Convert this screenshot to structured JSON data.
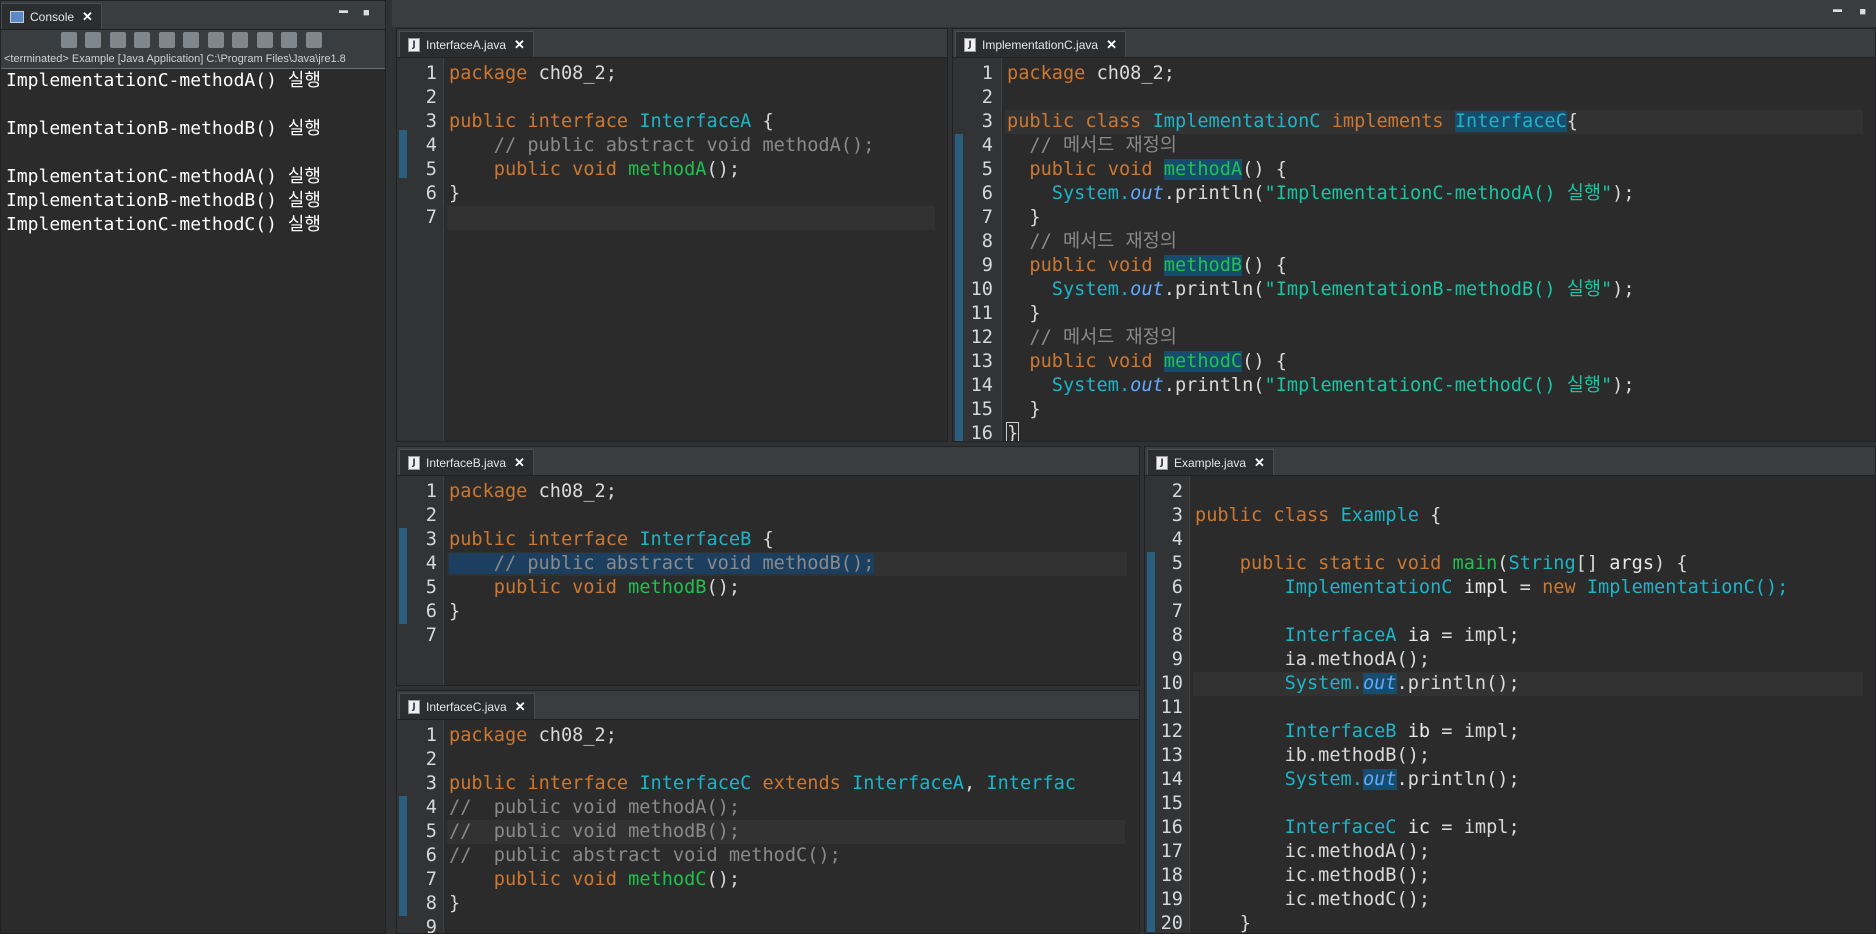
{
  "console": {
    "tab_label": "Console",
    "status": "<terminated> Example [Java Application] C:\\Program Files\\Java\\jre1.8",
    "output": [
      "ImplementationC-methodA() 실행",
      "",
      "ImplementationB-methodB() 실행",
      "",
      "ImplementationC-methodA() 실행",
      "ImplementationB-methodB() 실행",
      "ImplementationC-methodC() 실행"
    ]
  },
  "editors": {
    "interfaceA": {
      "tab": "InterfaceA.java",
      "line_numbers": [
        "1",
        "2",
        "3",
        "4",
        "5",
        "6",
        "7"
      ]
    },
    "implementationC": {
      "tab": "ImplementationC.java",
      "line_numbers": [
        "1",
        "2",
        "3",
        "4",
        "5",
        "6",
        "7",
        "8",
        "9",
        "10",
        "11",
        "12",
        "13",
        "14",
        "15",
        "16"
      ]
    },
    "interfaceB": {
      "tab": "InterfaceB.java",
      "line_numbers": [
        "1",
        "2",
        "3",
        "4",
        "5",
        "6",
        "7"
      ]
    },
    "interfaceC": {
      "tab": "InterfaceC.java",
      "line_numbers": [
        "1",
        "2",
        "3",
        "4",
        "5",
        "6",
        "7",
        "8",
        "9"
      ]
    },
    "example": {
      "tab": "Example.java",
      "line_numbers": [
        "2",
        "3",
        "4",
        "5",
        "6",
        "7",
        "8",
        "9",
        "10",
        "11",
        "12",
        "13",
        "14",
        "15",
        "16",
        "17",
        "18",
        "19",
        "20"
      ]
    }
  },
  "code": {
    "pkg_kw": "package",
    "pkg_name": "ch08_2;",
    "public": "public",
    "interface": "interface",
    "class": "class",
    "implements": "implements",
    "extends": "extends",
    "abstract": "abstract",
    "static": "static",
    "void": "void",
    "new": "new",
    "brace_open": "{",
    "brace_close": "}",
    "InterfaceA": "InterfaceA",
    "InterfaceB": "InterfaceB",
    "InterfaceC": "InterfaceC",
    "InterfaceC_brace": "InterfaceC",
    "ImplementationC": "ImplementationC",
    "Example": "Example",
    "methodA": "methodA",
    "methodB": "methodB",
    "methodC": "methodC",
    "paren_semi": "();",
    "paren_brace": "() {",
    "comment_abstract_A": "// public abstract void methodA();",
    "comment_abstract_B": "// public abstract void methodB();",
    "comment_override": "// 메서드 재정의",
    "comment_c4": "//  public void methodA();",
    "comment_c5": "//  public void methodB();",
    "comment_c6": "//  public abstract void methodC();",
    "truncated_interfac": "Interfac",
    "system": "System.",
    "out": "out",
    "println_open": ".println(",
    "str_A": "\"ImplementationC-methodA() 실행\"",
    "str_B": "\"ImplementationB-methodB() 실행\"",
    "str_C": "\"ImplementationC-methodC() 실행\"",
    "paren_close_semi": ");",
    "println_empty": ".println();",
    "main": "main",
    "String": "String",
    "args": "args",
    "impl": "impl",
    "ia": "ia",
    "ib": "ib",
    "ic": "ic",
    "eq": " = ",
    "ImplementationC_ctor": "ImplementationC();",
    "impl_semi": "impl;",
    "ia_methodA": "ia.methodA();",
    "ib_methodB": "ib.methodB();",
    "ic_methodA": "ic.methodA();",
    "ic_methodB": "ic.methodB();",
    "ic_methodC": "ic.methodC();",
    "comma": ", ",
    "brackets": "[] ",
    "paren_open": "(",
    "close_brace_only": ") {"
  },
  "colors": {
    "keyword": "#cc7832",
    "type": "#1eb4c8",
    "method": "#1fc14f",
    "comment": "#8a8a8a",
    "string": "#17c6a3",
    "background": "#2b2b2b"
  },
  "icons": {
    "console": "console-icon",
    "java_file": "java-file-icon",
    "close": "close-icon",
    "minimize": "minimize-icon",
    "maximize": "maximize-icon"
  },
  "window": {
    "close_glyph": "✕",
    "min_glyph": "▬",
    "max_glyph": "■"
  }
}
